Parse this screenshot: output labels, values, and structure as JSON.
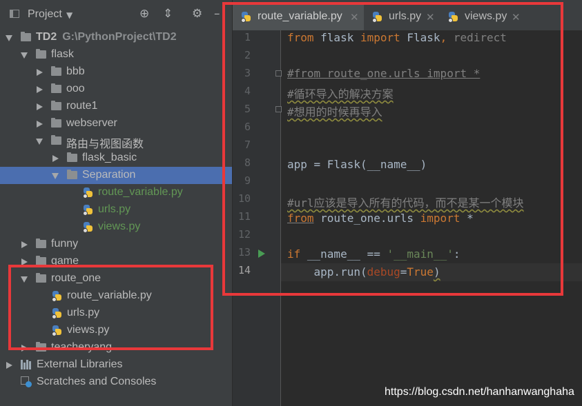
{
  "project_panel": {
    "title": "Project",
    "tree": [
      {
        "label": "TD2",
        "path": "G:\\PythonProject\\TD2",
        "kind": "folder",
        "expanded": true,
        "level": 0
      },
      {
        "label": "flask",
        "kind": "folder",
        "expanded": true,
        "level": 1
      },
      {
        "label": "bbb",
        "kind": "folder",
        "expanded": false,
        "level": 2
      },
      {
        "label": "ooo",
        "kind": "folder",
        "expanded": false,
        "level": 2
      },
      {
        "label": "route1",
        "kind": "folder",
        "expanded": false,
        "level": 2
      },
      {
        "label": "webserver",
        "kind": "folder",
        "expanded": false,
        "level": 2
      },
      {
        "label": "路由与视图函数",
        "kind": "folder",
        "expanded": true,
        "level": 2
      },
      {
        "label": "flask_basic",
        "kind": "folder",
        "expanded": false,
        "level": 3
      },
      {
        "label": "Separation",
        "kind": "folder",
        "expanded": true,
        "level": 3,
        "selected": true
      },
      {
        "label": "route_variable.py",
        "kind": "py",
        "level": 4,
        "color": "#629755"
      },
      {
        "label": "urls.py",
        "kind": "py",
        "level": 4,
        "color": "#629755"
      },
      {
        "label": "views.py",
        "kind": "py",
        "level": 4,
        "color": "#629755"
      },
      {
        "label": "funny",
        "kind": "folder",
        "expanded": false,
        "level": 1
      },
      {
        "label": "game",
        "kind": "folder",
        "expanded": false,
        "level": 1
      },
      {
        "label": "route_one",
        "kind": "folder",
        "expanded": true,
        "level": 1
      },
      {
        "label": "route_variable.py",
        "kind": "py",
        "level": 2
      },
      {
        "label": "urls.py",
        "kind": "py",
        "level": 2
      },
      {
        "label": "views.py",
        "kind": "py",
        "level": 2
      },
      {
        "label": "teacheryang",
        "kind": "folder",
        "expanded": false,
        "level": 1
      },
      {
        "label": "External Libraries",
        "kind": "libs",
        "expanded": false,
        "level": 0
      },
      {
        "label": "Scratches and Consoles",
        "kind": "scratches",
        "level": 0
      }
    ]
  },
  "editor": {
    "tabs": [
      {
        "label": "route_variable.py",
        "active": true
      },
      {
        "label": "urls.py",
        "active": false
      },
      {
        "label": "views.py",
        "active": false
      }
    ],
    "current_line": 14,
    "line_numbers": [
      "1",
      "2",
      "3",
      "4",
      "5",
      "6",
      "7",
      "8",
      "9",
      "10",
      "11",
      "12",
      "13",
      "14"
    ],
    "code": {
      "l1_from": "from",
      "l1_mod": " flask ",
      "l1_import": "import",
      "l1_names": " Flask",
      "l1_comma": ",",
      "l1_unused": " redirect",
      "l3": "#from route_one.urls import *",
      "l4": "#循环导入的解决方案",
      "l5": "#想用的时候再导入",
      "l8": "app = Flask(__name__)",
      "l10": "#url应该是导入所有的代码，而不是某一个模块",
      "l11_from": "from",
      "l11_mod": " route_one.urls ",
      "l11_import": "import",
      "l11_star": " *",
      "l13_if": "if",
      "l13_rest": " __name__ == ",
      "l13_str": "'__main__'",
      "l13_colon": ":",
      "l14_a": "    app.run(",
      "l14_param": "debug",
      "l14_eq": "=",
      "l14_true": "True",
      "l14_close": ")"
    }
  },
  "watermark": "https://blog.csdn.net/hanhanwanghaha",
  "colors": {
    "highlight_box": "#e8383a",
    "selection": "#4b6eaf",
    "keyword": "#cc7832"
  }
}
